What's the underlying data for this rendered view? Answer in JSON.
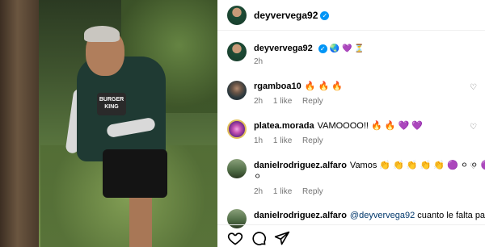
{
  "post": {
    "author": "deyvervega92",
    "verified": true,
    "caption_emojis": "🌏 💜 ⏳",
    "caption_time": "2h",
    "photo_sponsor": "BURGER KING"
  },
  "comments": [
    {
      "username": "rgamboa10",
      "text": "🔥 🔥 🔥",
      "time": "2h",
      "likes": "1 like",
      "reply_label": "Reply"
    },
    {
      "username": "platea.morada",
      "text": "VAMOOOO!! 🔥 🔥 💜 💜",
      "time": "1h",
      "likes": "1 like",
      "reply_label": "Reply"
    },
    {
      "username": "danielrodriguez.alfaro",
      "text": "Vamos 👏 👏 👏 👏 👏 🟣 ⚪ ⚪ 🟣 🟣",
      "text_wrap": "⚪",
      "time": "2h",
      "likes": "1 like",
      "reply_label": "Reply"
    },
    {
      "username": "danielrodriguez.alfaro",
      "mention": "@deyvervega92",
      "text": "cuanto le falta para"
    }
  ],
  "icons": {
    "like": "heart-icon",
    "comment": "comment-icon",
    "share": "send-icon",
    "verified": "verified-badge-icon"
  },
  "colors": {
    "verified": "#0095f6",
    "mention": "#00376b",
    "meta": "#737373"
  }
}
